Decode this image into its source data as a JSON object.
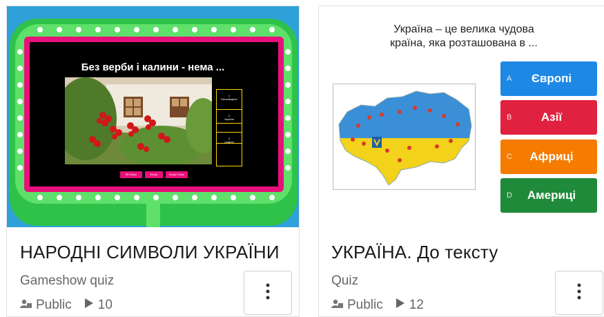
{
  "cards": [
    {
      "title": "НАРОДНІ СИМВОЛИ УКРАЇНИ",
      "type": "Gameshow quiz",
      "visibility": "Public",
      "plays": "10",
      "thumbnail": {
        "question": "Без верби і калини - нема ...",
        "answers": [
          "Батьківщини",
          "України",
          "родини"
        ],
        "answer_numbers": [
          "1",
          "2",
          "3"
        ],
        "buttons": [
          "50 бонус",
          "Бонус",
          "Бонус Опис"
        ]
      }
    },
    {
      "title": "УКРАЇНА. До тексту",
      "type": "Quiz",
      "visibility": "Public",
      "plays": "12",
      "thumbnail": {
        "question_line1": "Україна – це велика чудова",
        "question_line2": "країна, яка розташована в ...",
        "answers": [
          {
            "letter": "A",
            "text": "Європі",
            "color": "#1e88e5"
          },
          {
            "letter": "B",
            "text": "Азії",
            "color": "#e0213f"
          },
          {
            "letter": "C",
            "text": "Африці",
            "color": "#f57c00"
          },
          {
            "letter": "D",
            "text": "Америці",
            "color": "#1e8a3a"
          }
        ]
      }
    }
  ],
  "icons": {
    "visibility": "user-icon",
    "plays": "play-icon",
    "menu": "kebab-icon"
  }
}
